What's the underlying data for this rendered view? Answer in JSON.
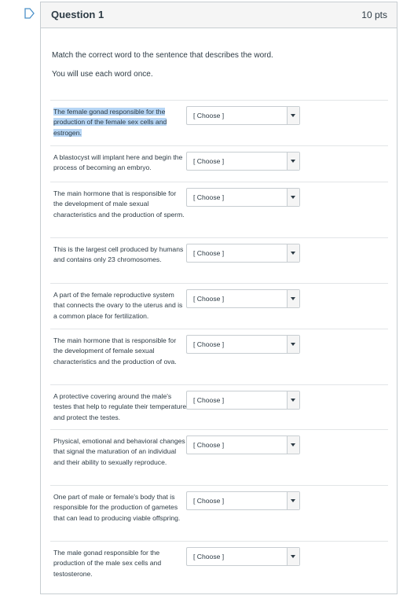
{
  "question": {
    "title": "Question 1",
    "points": "10 pts",
    "instruction_1": "Match the correct word to the sentence that describes the word.",
    "instruction_2": "You will use each word once."
  },
  "rows": [
    {
      "text": "The female gonad responsible for the production of the female sex cells and estrogen.",
      "selected": "[ Choose ]",
      "highlighted": true
    },
    {
      "text": "A blastocyst will implant here and begin the process of becoming an embryo.",
      "selected": "[ Choose ]"
    },
    {
      "text": "The main hormone that is responsible for the development of male sexual characteristics and the production of sperm.",
      "selected": "[ Choose ]"
    },
    {
      "text": "This is the largest cell produced by humans and contains only 23 chromosomes.",
      "selected": "[ Choose ]"
    },
    {
      "text": "A part of the female reproductive system that connects the ovary to the uterus and is a common place for fertilization.",
      "selected": "[ Choose ]"
    },
    {
      "text": "The main hormone that is responsible for the development of female sexual characteristics and the production of ova.",
      "selected": "[ Choose ]"
    },
    {
      "text": "A protective covering around the male's testes that help to regulate their temperature and protect the testes.",
      "selected": "[ Choose ]"
    },
    {
      "text": "Physical, emotional and behavioral changes that signal the maturation of an individual and their ability to sexually reproduce.",
      "selected": "[ Choose ]"
    },
    {
      "text": "One part of male or female's body that is responsible for the production of gametes that can lead to producing viable offspring.",
      "selected": "[ Choose ]"
    },
    {
      "text": "The male gonad responsible for the production of the male sex cells and testosterone.",
      "selected": "[ Choose ]"
    }
  ],
  "colors": {
    "flag": "#4a90c8",
    "border": "#c7cdd1",
    "highlight": "#b7d6f5"
  },
  "icons": {
    "flag": "bookmark-flag-icon",
    "dropdown": "triangle-down-icon"
  }
}
